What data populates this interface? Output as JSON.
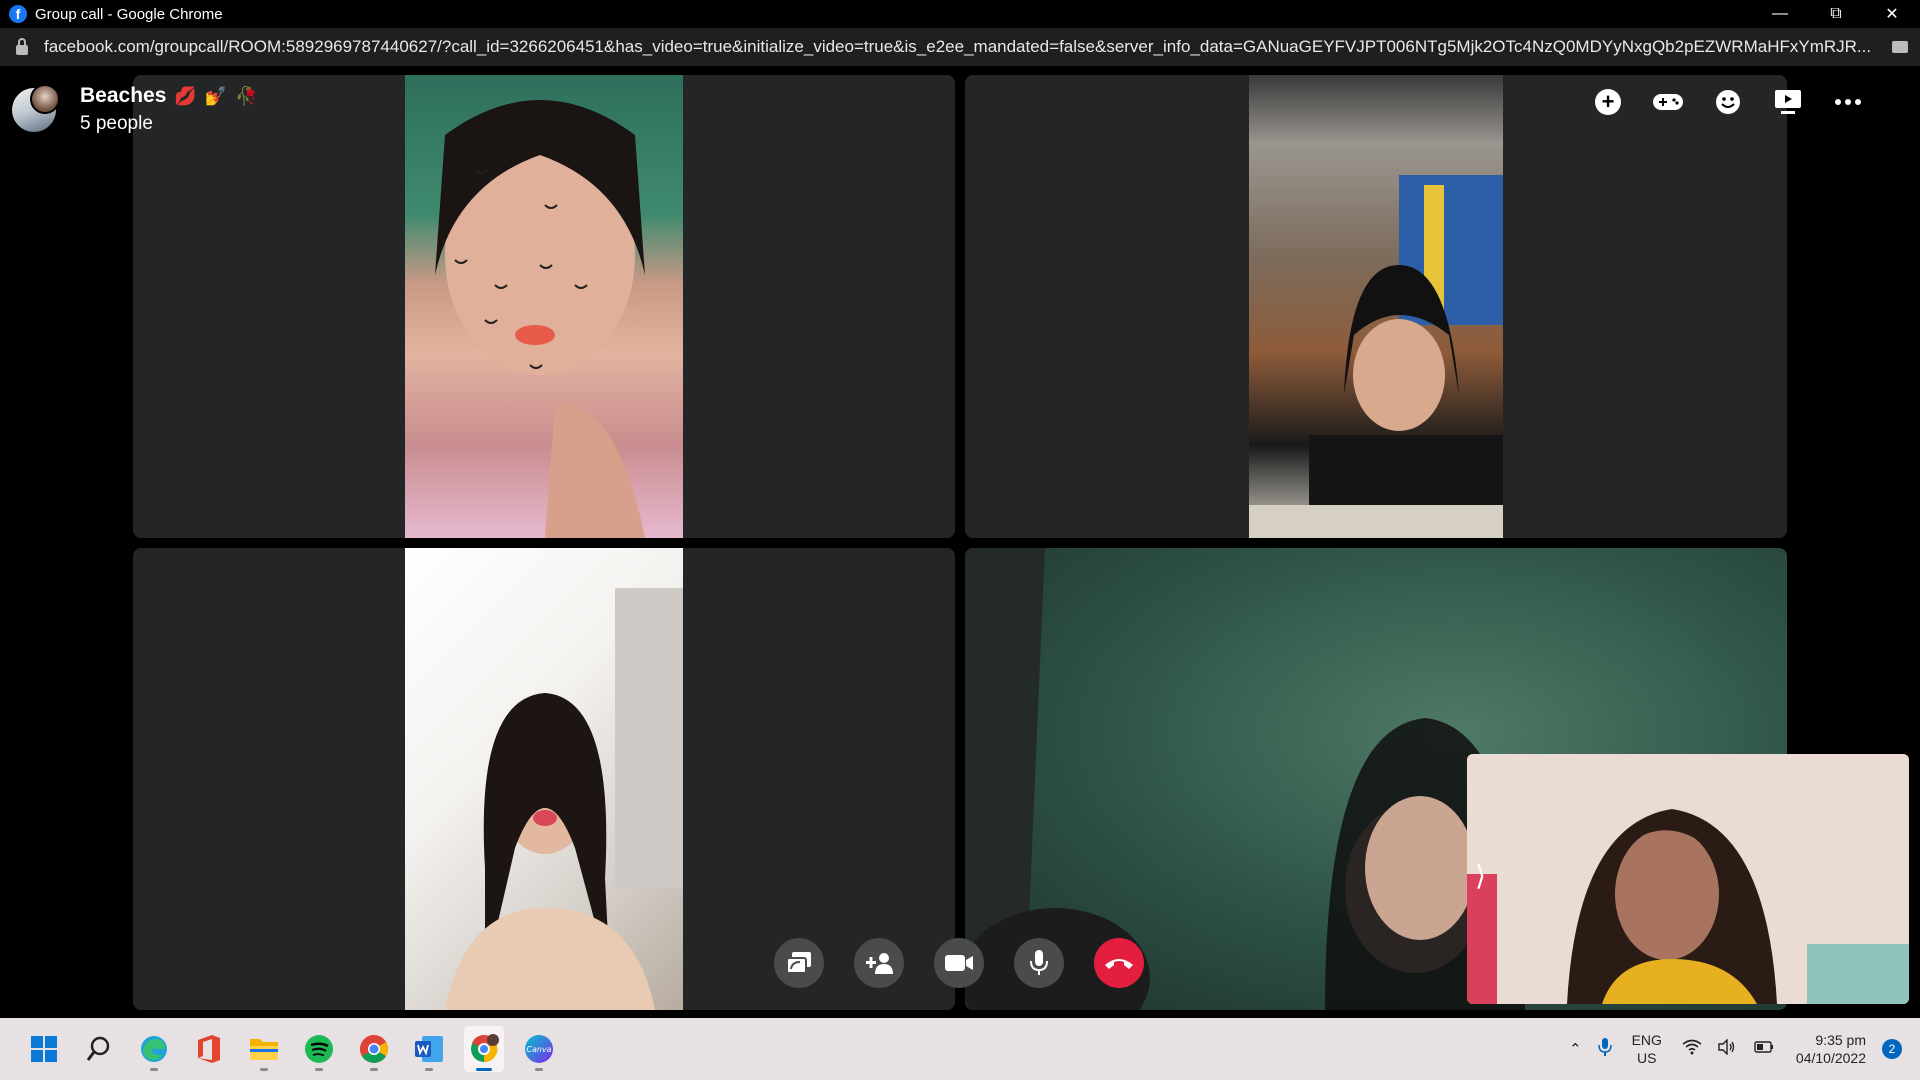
{
  "window": {
    "title": "Group call - Google Chrome",
    "url": "facebook.com/groupcall/ROOM:5892969787440627/?call_id=3266206451&has_video=true&initialize_video=true&is_e2ee_mandated=false&server_info_data=GANuaGEYFVJPT006NTg5Mjk2OTc4NzQ0MDYyNxgQb2pEZWRMaHFxYmRJR...",
    "favicon": "f"
  },
  "call": {
    "group_name": "Beaches",
    "emojis": [
      "💋",
      "💅",
      "🥀"
    ],
    "people_count": "5 people",
    "top_actions": [
      "add-icon",
      "game-controller-icon",
      "emoji-icon",
      "screen-share-icon",
      "more-icon"
    ],
    "controls": [
      "share-screen-icon",
      "add-person-icon",
      "video-camera-icon",
      "microphone-icon",
      "end-call-icon"
    ],
    "end_call_color": "#e41e3f"
  },
  "taskbar": {
    "apps": [
      "start",
      "search",
      "edge",
      "office",
      "file-explorer",
      "spotify",
      "chrome",
      "word",
      "chrome-profile",
      "canva"
    ],
    "language": "ENG",
    "region": "US",
    "time": "9:35 pm",
    "date": "04/10/2022",
    "notifications": "2"
  }
}
